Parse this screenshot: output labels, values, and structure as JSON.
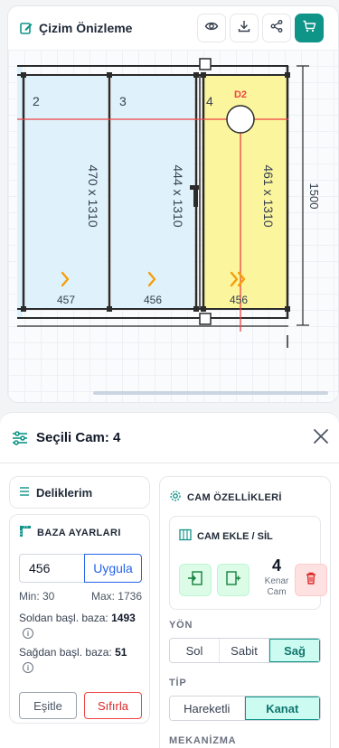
{
  "preview": {
    "title": "Çizim Önizleme",
    "icons": [
      "edit-icon",
      "eye-icon",
      "download-icon",
      "share-icon",
      "cart-icon"
    ]
  },
  "drawing": {
    "total_height": "1500",
    "panels": [
      {
        "number": "2",
        "size": "470 x 1310",
        "bottom": "457",
        "arrows": ">"
      },
      {
        "number": "3",
        "size": "444 x 1310",
        "bottom": "456",
        "arrows": ">"
      },
      {
        "number": "4",
        "size": "461 x 1310",
        "bottom": "456",
        "arrows": ">>",
        "hole": "D2"
      }
    ],
    "colors": {
      "glass": "#dff2fb",
      "selected": "#fbf59d",
      "frame": "#2b2b2b",
      "arrow": "#f59e0b",
      "guide": "#ef4444"
    }
  },
  "selected": {
    "title": "Seçili Cam: 4"
  },
  "holes": {
    "label": "Deliklerim"
  },
  "baza": {
    "title": "BAZA AYARLARI",
    "value": "456",
    "apply": "Uygula",
    "min": "Min: 30",
    "max": "Max: 1736",
    "left_label": "Soldan başl. baza:",
    "left_value": "1493",
    "right_label": "Sağdan başl. baza:",
    "right_value": "51",
    "equalize": "Eşitle",
    "reset": "Sıfırla"
  },
  "props": {
    "title": "CAM ÖZELLİKLERİ",
    "add_remove_title": "CAM EKLE / SİL",
    "count": "4",
    "count_label_1": "Kenar",
    "count_label_2": "Cam",
    "direction_label": "YÖN",
    "direction_options": [
      "Sol",
      "Sabit",
      "Sağ"
    ],
    "direction_selected": "Sağ",
    "type_label": "TİP",
    "type_options": [
      "Hareketli",
      "Kanat"
    ],
    "type_selected": "Kanat",
    "mechanism_label": "MEKANİZMA"
  }
}
